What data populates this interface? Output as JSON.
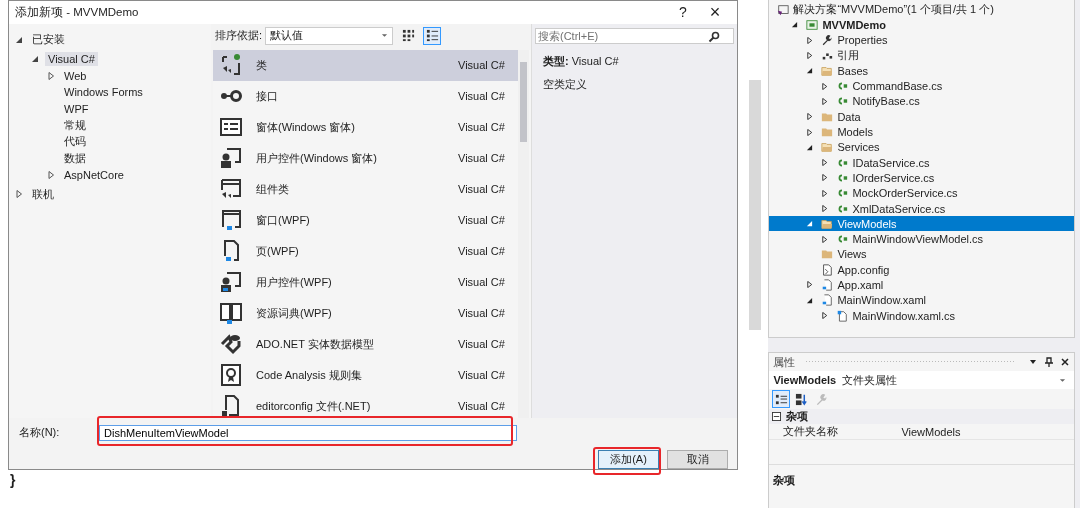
{
  "dialog": {
    "title": "添加新项 - MVVMDemo",
    "help": "?",
    "close": "×"
  },
  "categories": [
    {
      "label": "已安装",
      "expanded": true,
      "selected": false,
      "children": [
        {
          "label": "Visual C#",
          "expanded": true,
          "selected": true,
          "children": [
            {
              "label": "Web",
              "expanded": false,
              "selected": false
            },
            {
              "label": "Windows Forms",
              "selected": false
            },
            {
              "label": "WPF",
              "selected": false
            },
            {
              "label": "常规",
              "selected": false
            },
            {
              "label": "代码",
              "selected": false
            },
            {
              "label": "数据",
              "selected": false
            },
            {
              "label": "AspNetCore",
              "expanded": false,
              "selected": false
            }
          ]
        }
      ]
    },
    {
      "label": "联机",
      "expanded": false,
      "selected": false
    }
  ],
  "sort": {
    "label": "排序依据:",
    "value": "默认值"
  },
  "views": [
    {
      "kind": "grid",
      "selected": false
    },
    {
      "kind": "list",
      "selected": true
    }
  ],
  "search": {
    "placeholder": "搜索(Ctrl+E)"
  },
  "templates": [
    {
      "kind": "class",
      "name": "类",
      "language": "Visual C#",
      "selected": true
    },
    {
      "kind": "interface",
      "name": "接口",
      "language": "Visual C#",
      "selected": false
    },
    {
      "kind": "form",
      "name": "窗体(Windows 窗体)",
      "language": "Visual C#",
      "selected": false
    },
    {
      "kind": "usercontrol",
      "name": "用户控件(Windows 窗体)",
      "language": "Visual C#",
      "selected": false
    },
    {
      "kind": "component",
      "name": "组件类",
      "language": "Visual C#",
      "selected": false
    },
    {
      "kind": "window",
      "name": "窗口(WPF)",
      "language": "Visual C#",
      "selected": false
    },
    {
      "kind": "page",
      "name": "页(WPF)",
      "language": "Visual C#",
      "selected": false
    },
    {
      "kind": "wpfcontrol",
      "name": "用户控件(WPF)",
      "language": "Visual C#",
      "selected": false
    },
    {
      "kind": "dictionary",
      "name": "资源词典(WPF)",
      "language": "Visual C#",
      "selected": false
    },
    {
      "kind": "ado",
      "name": "ADO.NET 实体数据模型",
      "language": "Visual C#",
      "selected": false
    },
    {
      "kind": "ruleset",
      "name": "Code Analysis 规则集",
      "language": "Visual C#",
      "selected": false
    },
    {
      "kind": "file",
      "name": "editorconfig 文件(.NET)",
      "language": "Visual C#",
      "selected": false
    }
  ],
  "details": {
    "type": "**类型:** Visual C#",
    "description": "空类定义"
  },
  "name_field": {
    "label": "名称(N):",
    "value": "DishMenuItemViewModel"
  },
  "buttons": [
    {
      "label": "添加(A)",
      "kind": "primary"
    },
    {
      "label": "取消",
      "kind": "normal"
    }
  ],
  "editor": {
    "text": "}"
  },
  "solution": [
    {
      "kind": "solution",
      "label": "解决方案“MVVMDemo”(1 个项目/共 1 个)",
      "selected": false,
      "children": [
        {
          "kind": "project",
          "label": "MVVMDemo",
          "expanded": true,
          "selected": false,
          "children": [
            {
              "kind": "wrench",
              "label": "Properties",
              "expanded": false,
              "selected": false
            },
            {
              "kind": "references",
              "label": "引用",
              "expanded": false,
              "selected": false
            },
            {
              "kind": "folder-open",
              "label": "Bases",
              "expanded": true,
              "selected": false,
              "children": [
                {
                  "kind": "cs",
                  "label": "CommandBase.cs",
                  "expanded": false,
                  "selected": false
                },
                {
                  "kind": "cs",
                  "label": "NotifyBase.cs",
                  "expanded": false,
                  "selected": false
                }
              ]
            },
            {
              "kind": "folder",
              "label": "Data",
              "expanded": false,
              "selected": false
            },
            {
              "kind": "folder",
              "label": "Models",
              "expanded": false,
              "selected": false
            },
            {
              "kind": "folder-open",
              "label": "Services",
              "expanded": true,
              "selected": false,
              "children": [
                {
                  "kind": "cs",
                  "label": "IDataService.cs",
                  "expanded": false,
                  "selected": false
                },
                {
                  "kind": "cs",
                  "label": "IOrderService.cs",
                  "expanded": false,
                  "selected": false
                },
                {
                  "kind": "cs",
                  "label": "MockOrderService.cs",
                  "expanded": false,
                  "selected": false
                },
                {
                  "kind": "cs",
                  "label": "XmlDataService.cs",
                  "expanded": false,
                  "selected": false
                }
              ]
            },
            {
              "kind": "folder-open",
              "label": "ViewModels",
              "expanded": true,
              "selected": true,
              "children": [
                {
                  "kind": "cs",
                  "label": "MainWindowViewModel.cs",
                  "expanded": false,
                  "selected": false
                }
              ]
            },
            {
              "kind": "folder",
              "label": "Views",
              "selected": false
            },
            {
              "kind": "config",
              "label": "App.config",
              "selected": false
            },
            {
              "kind": "xaml",
              "label": "App.xaml",
              "expanded": false,
              "selected": false
            },
            {
              "kind": "xaml",
              "label": "MainWindow.xaml",
              "expanded": true,
              "selected": false,
              "children": [
                {
                  "kind": "xamlcs",
                  "label": "MainWindow.xaml.cs",
                  "expanded": false,
                  "selected": false
                }
              ]
            }
          ]
        }
      ]
    }
  ],
  "properties": {
    "title": "属性",
    "object_name": "ViewModels",
    "object_type": "文件夹属性",
    "toolbar": [
      {
        "kind": "categorized",
        "selected": true,
        "disabled": false
      },
      {
        "kind": "alphabetical",
        "selected": false,
        "disabled": false
      },
      {
        "kind": "pages",
        "selected": false,
        "disabled": true
      }
    ],
    "category": {
      "label": "杂项",
      "expanded": true
    },
    "rows": [
      {
        "name": "文件夹名称",
        "value": "ViewModels"
      }
    ],
    "description_title": "杂项"
  }
}
